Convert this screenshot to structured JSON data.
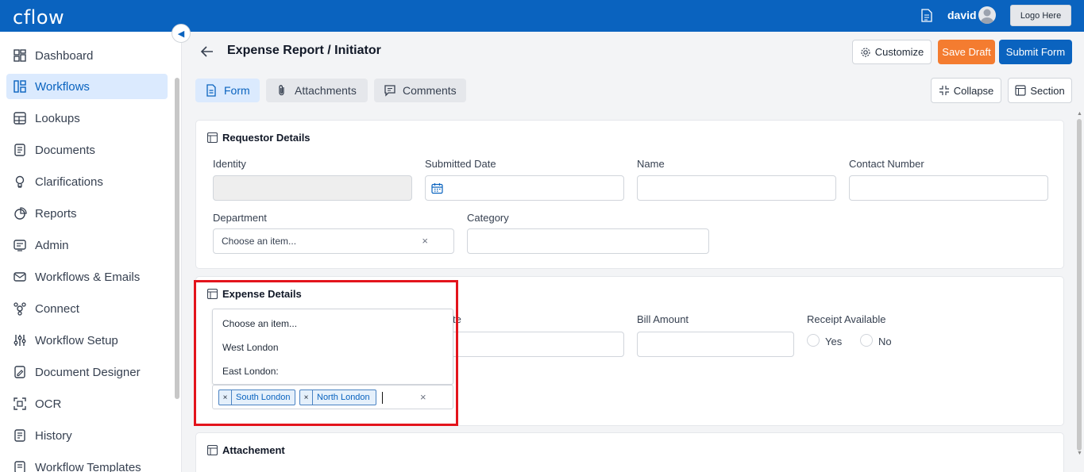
{
  "topbar": {
    "logo": "cflow",
    "username": "david",
    "logo_button": "Logo Here"
  },
  "sidebar": {
    "items": [
      {
        "label": "Dashboard",
        "icon": "dashboard-icon"
      },
      {
        "label": "Workflows",
        "icon": "workflows-icon",
        "active": true
      },
      {
        "label": "Lookups",
        "icon": "table-icon"
      },
      {
        "label": "Documents",
        "icon": "document-icon"
      },
      {
        "label": "Clarifications",
        "icon": "lightbulb-icon"
      },
      {
        "label": "Reports",
        "icon": "pie-chart-icon"
      },
      {
        "label": "Admin",
        "icon": "admin-icon"
      },
      {
        "label": "Workflows & Emails",
        "icon": "mail-icon"
      },
      {
        "label": "Connect",
        "icon": "connect-icon"
      },
      {
        "label": "Workflow Setup",
        "icon": "sliders-icon"
      },
      {
        "label": "Document Designer",
        "icon": "designer-icon"
      },
      {
        "label": "OCR",
        "icon": "ocr-icon"
      },
      {
        "label": "History",
        "icon": "history-icon"
      },
      {
        "label": "Workflow Templates",
        "icon": "templates-icon"
      }
    ]
  },
  "header": {
    "title": "Expense Report / Initiator",
    "customize": "Customize",
    "save_draft": "Save Draft",
    "submit": "Submit Form"
  },
  "tabs": {
    "form": "Form",
    "attachments": "Attachments",
    "comments": "Comments",
    "collapse": "Collapse",
    "section": "Section"
  },
  "requestor": {
    "title": "Requestor Details",
    "identity": "Identity",
    "submitted_date": "Submitted Date",
    "name": "Name",
    "contact_number": "Contact Number",
    "department": "Department",
    "department_placeholder": "Choose an item...",
    "category": "Category"
  },
  "expense": {
    "title": "Expense Details",
    "date_label_partial": "te",
    "bill_amount": "Bill Amount",
    "receipt_available": "Receipt Available",
    "yes": "Yes",
    "no": "No",
    "dropdown_options": [
      "Choose an item...",
      "West London",
      "East London:"
    ],
    "selected_chips": [
      "South London",
      "North London"
    ]
  },
  "attachment": {
    "title": "Attachement"
  },
  "colors": {
    "brand": "#0a63bf",
    "draft": "#f47c30",
    "highlight": "#e3141c"
  }
}
